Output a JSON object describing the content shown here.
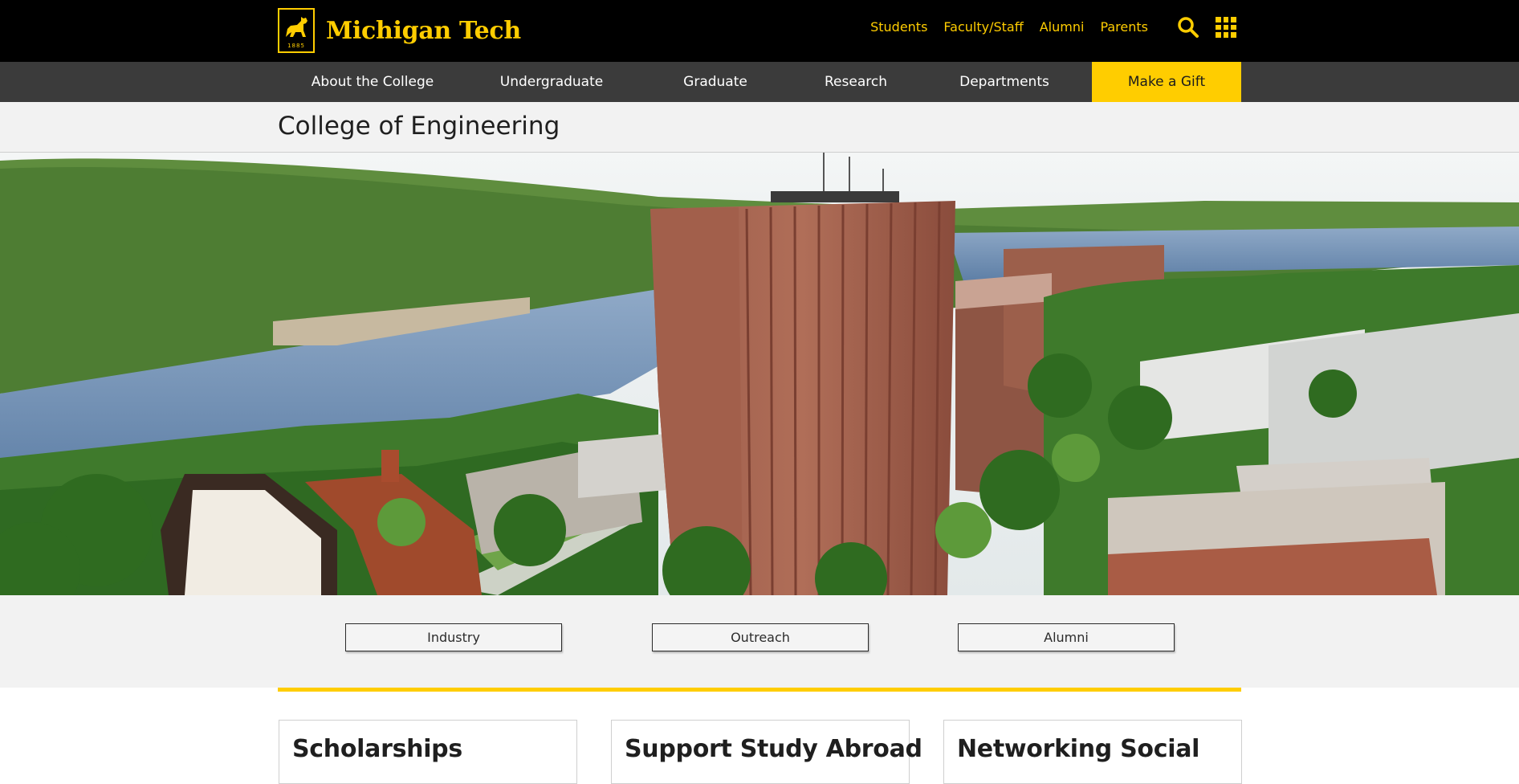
{
  "header": {
    "brand": "Michigan Tech",
    "logo_year": "1885",
    "audience_links": [
      "Students",
      "Faculty/Staff",
      "Alumni",
      "Parents"
    ],
    "search_icon": "search-icon",
    "menu_icon": "grid-menu-icon",
    "accent_color": "#ffcd00"
  },
  "nav": {
    "items": [
      "About the College",
      "Undergraduate",
      "Graduate",
      "Research",
      "Departments"
    ],
    "gift_label": "Make a Gift"
  },
  "page": {
    "title": "College of Engineering"
  },
  "quick_links": [
    "Industry",
    "Outreach",
    "Alumni"
  ],
  "cards": [
    "Scholarships",
    "Support Study Abroad",
    "Networking Social"
  ]
}
